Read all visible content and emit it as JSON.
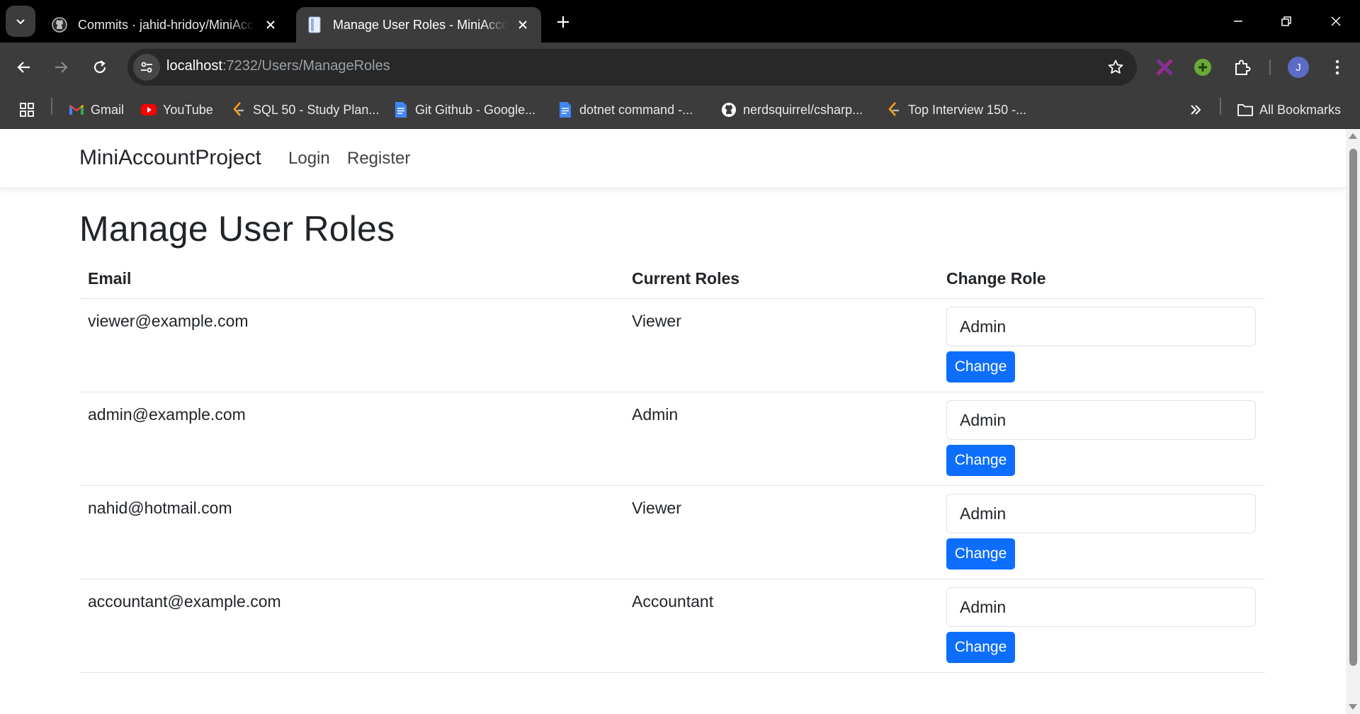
{
  "browser": {
    "tabs": [
      {
        "title": "Commits · jahid-hridoy/MiniAccountProject",
        "icon": "github-icon",
        "active": false
      },
      {
        "title": "Manage User Roles - MiniAccountProject",
        "icon": "page-icon",
        "active": true
      }
    ],
    "address_bar": {
      "host": "localhost",
      "path": ":7232/Users/ManageRoles"
    },
    "profile_initial": "J",
    "bookmarks": [
      {
        "label": "Gmail",
        "icon": "gmail-icon"
      },
      {
        "label": "YouTube",
        "icon": "youtube-icon"
      },
      {
        "label": "SQL 50 - Study Plan...",
        "icon": "leetcode-icon"
      },
      {
        "label": "Git Github - Google...",
        "icon": "docs-icon"
      },
      {
        "label": "dotnet command -...",
        "icon": "docs-icon"
      },
      {
        "label": "nerdsquirrel/csharp...",
        "icon": "github-icon"
      },
      {
        "label": "Top Interview 150 -...",
        "icon": "leetcode-icon"
      }
    ],
    "all_bookmarks_label": "All Bookmarks"
  },
  "site": {
    "brand": "MiniAccountProject",
    "nav": {
      "login": "Login",
      "register": "Register"
    }
  },
  "page": {
    "title": "Manage User Roles",
    "columns": {
      "email": "Email",
      "roles": "Current Roles",
      "change": "Change Role"
    },
    "rows": [
      {
        "email": "viewer@example.com",
        "role": "Viewer",
        "selected_role": "Admin",
        "button": "Change"
      },
      {
        "email": "admin@example.com",
        "role": "Admin",
        "selected_role": "Admin",
        "button": "Change"
      },
      {
        "email": "nahid@hotmail.com",
        "role": "Viewer",
        "selected_role": "Admin",
        "button": "Change"
      },
      {
        "email": "accountant@example.com",
        "role": "Accountant",
        "selected_role": "Admin",
        "button": "Change"
      }
    ]
  },
  "colors": {
    "primary_button": "#0d6efd",
    "chrome_dark": "#3c3c3c",
    "tabstrip": "#000000"
  }
}
